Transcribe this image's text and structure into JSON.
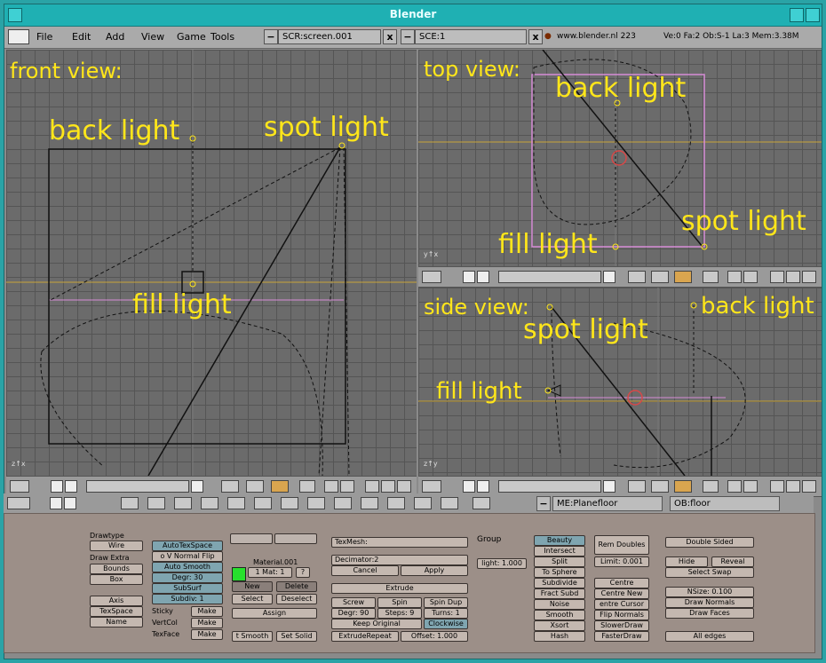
{
  "window": {
    "title": "Blender"
  },
  "menubar": {
    "items": [
      "File",
      "Edit",
      "Add",
      "View",
      "Game",
      "Tools"
    ],
    "screen_field": "SCR:screen.001",
    "scene_field": "SCE:1",
    "website": "www.blender.nl  223",
    "stats": "Ve:0 Fa:2  Ob:S-1 La:3  Mem:3.38M"
  },
  "viewports": {
    "front": {
      "title": "front view:",
      "labels": {
        "back": "back light",
        "spot": "spot light",
        "fill": "fill light"
      }
    },
    "top": {
      "title": "top view:",
      "labels": {
        "back": "back light",
        "spot": "spot light",
        "fill": "fill light"
      }
    },
    "side": {
      "title": "side view:",
      "labels": {
        "back": "back light",
        "spot": "spot light",
        "fill": "fill light"
      }
    }
  },
  "buttons_header": {
    "mesh_field": "ME:Planefloor",
    "object_field": "OB:floor"
  },
  "edit_buttons": {
    "drawtype": "Drawtype",
    "drawtype_value": "Wire",
    "draw_extra": "Draw Extra",
    "bounds": "Bounds",
    "box": "Box",
    "axis": "Axis",
    "texspace": "TexSpace",
    "name": "Name",
    "auto_texspace": "AutoTexSpace",
    "no_v_normal_flip": "o V Normal Flip",
    "auto_smooth": "Auto Smooth",
    "degr": "Degr: 30",
    "subsurf": "SubSurf",
    "subdiv": "Subdiv: 1",
    "sticky": "Sticky",
    "vertcol": "VertCol",
    "texface": "TexFace",
    "make": "Make",
    "material": "Material.001",
    "mat_count": "1 Mat: 1",
    "mat_q": "?",
    "new": "New",
    "delete": "Delete",
    "select": "Select",
    "deselect": "Deselect",
    "assign": "Assign",
    "set_smooth": "t Smooth",
    "set_solid": "Set Solid",
    "texmesh": "TexMesh:",
    "decimator": "Decimator:2",
    "cancel": "Cancel",
    "apply": "Apply",
    "extrude": "Extrude",
    "screw": "Screw",
    "spin": "Spin",
    "spin_dup": "Spin Dup",
    "degr90": "Degr: 90",
    "steps": "Steps: 9",
    "turns": "Turns: 1",
    "keep_original": "Keep Original",
    "clockwise": "Clockwise",
    "extrude_repeat": "ExtrudeRepeat",
    "offset": "Offset: 1.000",
    "group": "Group",
    "limit_field": "light: 1.000",
    "beauty": "Beauty",
    "intersect": "Intersect",
    "split": "Split",
    "to_sphere": "To Sphere",
    "subdivide": "Subdivide",
    "fract_subd": "Fract Subd",
    "noise": "Noise",
    "smooth": "Smooth",
    "xsort": "Xsort",
    "hash": "Hash",
    "rem_doubles": "Rem Doubles",
    "limit": "Limit: 0.001",
    "centre": "Centre",
    "centre_new": "Centre New",
    "centre_cursor": "entre Cursor",
    "flip_normals": "Flip Normals",
    "slower_draw": "SlowerDraw",
    "faster_draw": "FasterDraw",
    "double_sided": "Double Sided",
    "hide": "Hide",
    "reveal": "Reveal",
    "select_swap": "Select Swap",
    "nsize": "NSize: 0.100",
    "draw_normals": "Draw Normals",
    "draw_faces": "Draw Faces",
    "all_edges": "All edges"
  }
}
